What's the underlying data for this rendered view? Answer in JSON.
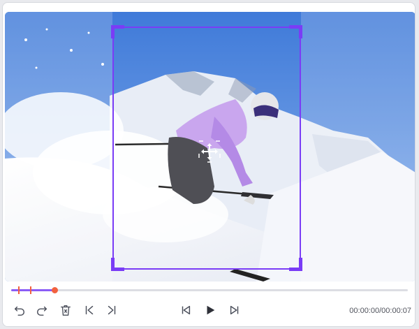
{
  "editor": {
    "time_current": "00:00:00",
    "time_total": "00:00:07",
    "progress_fraction": 0.11
  },
  "icons": {
    "undo": "undo-icon",
    "redo": "redo-icon",
    "delete": "trash-icon",
    "mark_in": "mark-in-icon",
    "mark_out": "mark-out-icon",
    "prev": "skip-previous-icon",
    "play": "play-icon",
    "next": "skip-next-icon",
    "move": "move-arrows-icon"
  },
  "colors": {
    "accent": "#7a3cf6",
    "progress": "#8b5cf6",
    "playhead": "#f2613f"
  }
}
